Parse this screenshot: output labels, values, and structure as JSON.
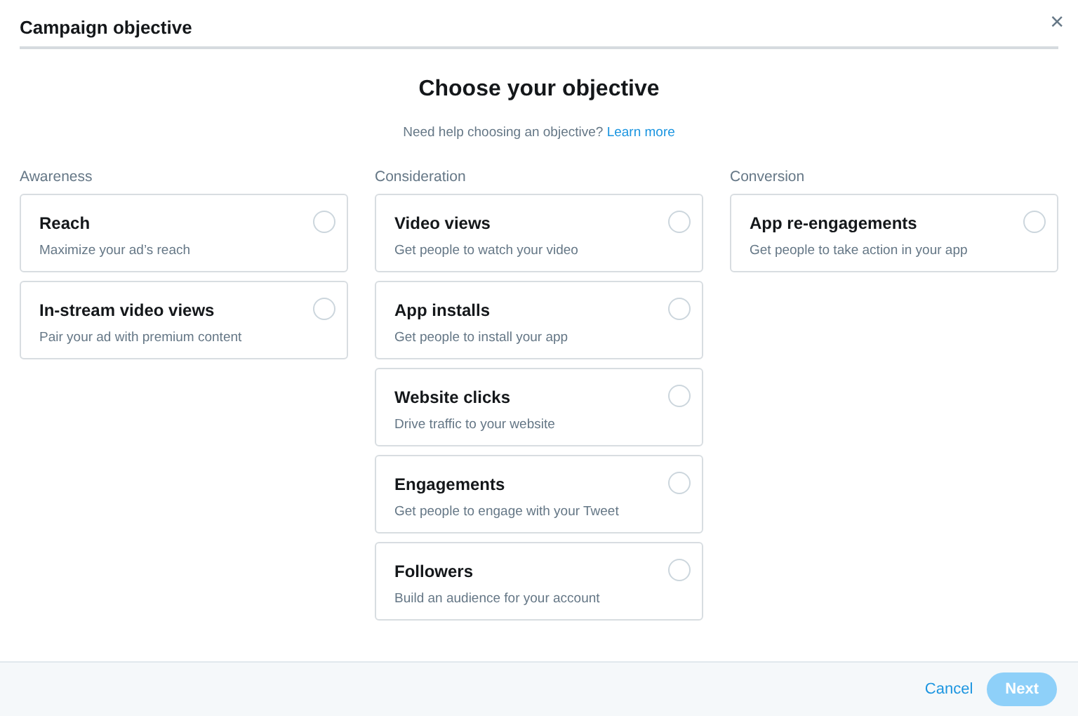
{
  "window": {
    "title": "Campaign objective",
    "close": "×"
  },
  "heading": "Choose your objective",
  "help": {
    "text": "Need help choosing an objective?",
    "link": "Learn more"
  },
  "groups": [
    {
      "label": "Awareness",
      "options": [
        {
          "title": "Reach",
          "description": "Maximize your ad’s reach",
          "selected": false
        },
        {
          "title": "In-stream video views",
          "description": "Pair your ad with premium content",
          "selected": false
        }
      ]
    },
    {
      "label": "Consideration",
      "options": [
        {
          "title": "Video views",
          "description": "Get people to watch your video",
          "selected": false
        },
        {
          "title": "App installs",
          "description": "Get people to install your app",
          "selected": false
        },
        {
          "title": "Website clicks",
          "description": "Drive traffic to your website",
          "selected": false
        },
        {
          "title": "Engagements",
          "description": "Get people to engage with your Tweet",
          "selected": false
        },
        {
          "title": "Followers",
          "description": "Build an audience for your account",
          "selected": false
        }
      ]
    },
    {
      "label": "Conversion",
      "options": [
        {
          "title": "App re-engagements",
          "description": "Get people to take action in your app",
          "selected": false
        }
      ]
    }
  ],
  "buttons": [
    {
      "label": "Cancel",
      "kind": "link",
      "disabled": false
    },
    {
      "label": "Next",
      "kind": "primary",
      "disabled": true
    }
  ]
}
